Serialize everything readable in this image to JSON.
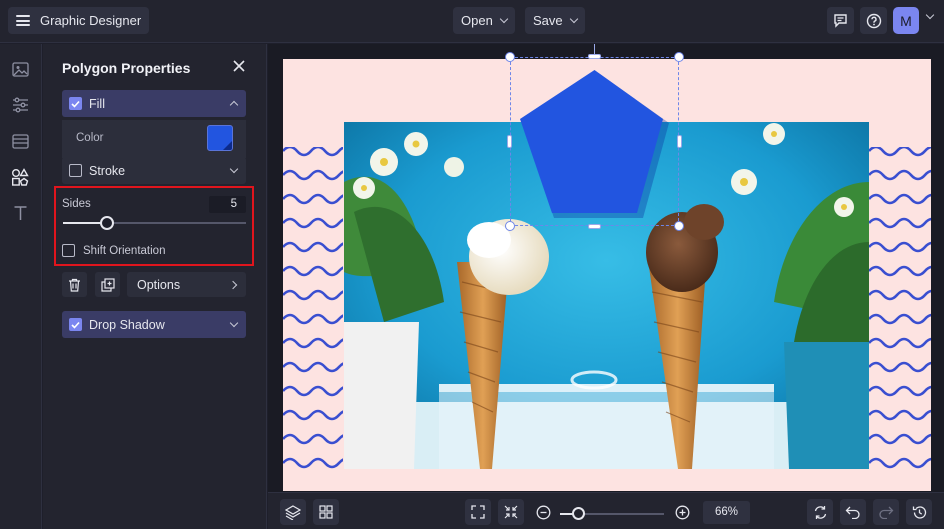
{
  "app": {
    "title": "Graphic Designer",
    "open_label": "Open",
    "save_label": "Save",
    "avatar_initial": "M"
  },
  "panel": {
    "title": "Polygon Properties",
    "fill": {
      "label": "Fill",
      "checked": true,
      "expanded": true
    },
    "color": {
      "label": "Color",
      "value": "#2255E0"
    },
    "stroke": {
      "label": "Stroke",
      "checked": false
    },
    "sides": {
      "label": "Sides",
      "value": "5"
    },
    "shift_orientation": {
      "label": "Shift Orientation",
      "checked": false
    },
    "options_label": "Options",
    "drop_shadow": {
      "label": "Drop Shadow",
      "checked": true
    }
  },
  "bottom": {
    "zoom": "66%"
  },
  "colors": {
    "accent": "#7B86F0",
    "polygon": "#2255E0",
    "highlight": "#E0151D",
    "artboard": "#FDE3E1"
  },
  "icons": {
    "rail": [
      "image-icon",
      "sliders-icon",
      "layout-icon",
      "shapes-icon",
      "text-icon"
    ],
    "topbar": [
      "comment-icon",
      "help-icon"
    ],
    "bottombar": [
      "layers-icon",
      "grid-icon",
      "fit-screen-icon",
      "shrink-icon",
      "zoom-out-icon",
      "zoom-in-icon",
      "replace-icon",
      "undo-icon",
      "redo-icon",
      "history-icon"
    ]
  }
}
